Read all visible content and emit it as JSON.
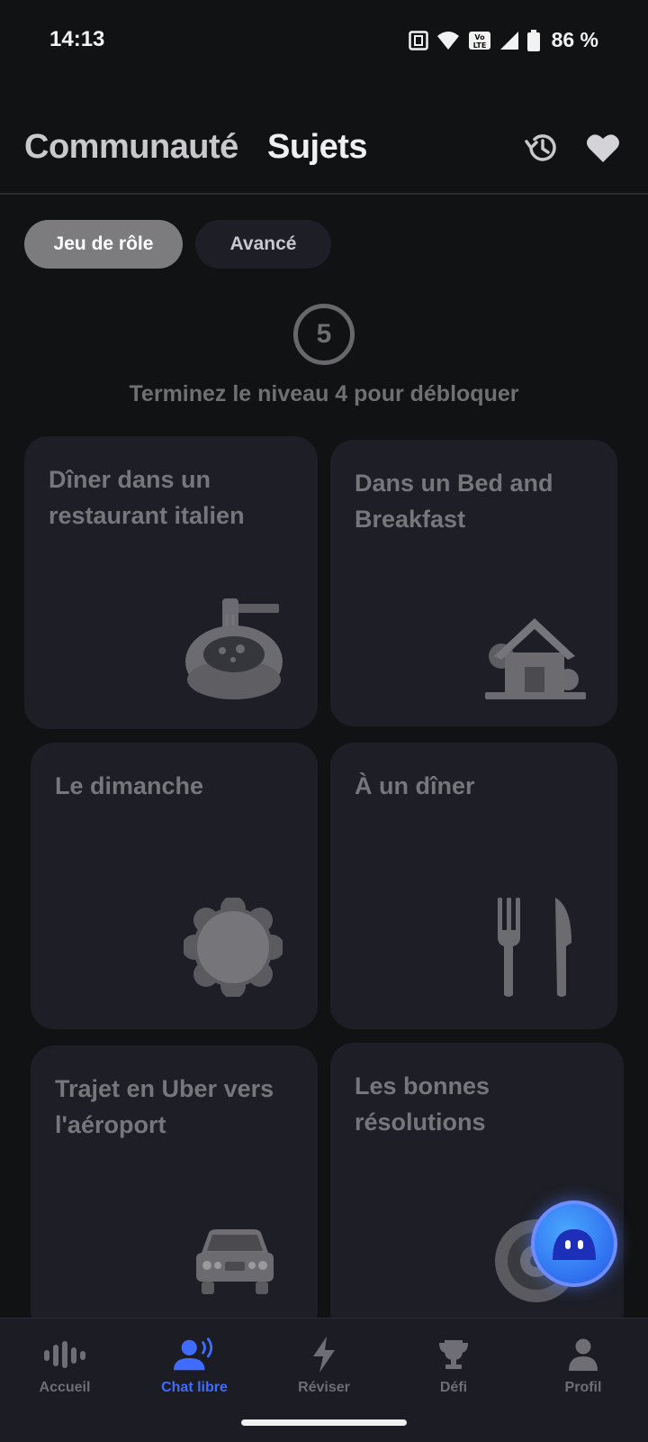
{
  "status_bar": {
    "time": "14:13",
    "battery": "86 %"
  },
  "header": {
    "tab_community": "Communauté",
    "tab_topics": "Sujets"
  },
  "chips": {
    "roleplay": "Jeu de rôle",
    "advanced": "Avancé"
  },
  "lock_notice": {
    "level": "5",
    "text": "Terminez le niveau 4 pour débloquer"
  },
  "cards": [
    {
      "title": "Dîner dans un restaurant italien",
      "icon": "pasta-bowl-icon"
    },
    {
      "title": "Dans un Bed and Breakfast",
      "icon": "house-icon"
    },
    {
      "title": "Le dimanche",
      "icon": "sun-icon"
    },
    {
      "title": "À un dîner",
      "icon": "fork-knife-icon"
    },
    {
      "title": "Trajet en Uber vers l'aéroport",
      "icon": "car-icon"
    },
    {
      "title": "Les bonnes résolutions",
      "icon": "target-icon"
    }
  ],
  "nav": [
    {
      "label": "Accueil",
      "icon": "waveform-icon",
      "active": false
    },
    {
      "label": "Chat libre",
      "icon": "voice-chat-icon",
      "active": true
    },
    {
      "label": "Réviser",
      "icon": "lightning-icon",
      "active": false
    },
    {
      "label": "Défi",
      "icon": "trophy-icon",
      "active": false
    },
    {
      "label": "Profil",
      "icon": "person-icon",
      "active": false
    }
  ],
  "colors": {
    "accent": "#3f6cff",
    "card_bg": "#1d1e26",
    "background": "#111213"
  }
}
